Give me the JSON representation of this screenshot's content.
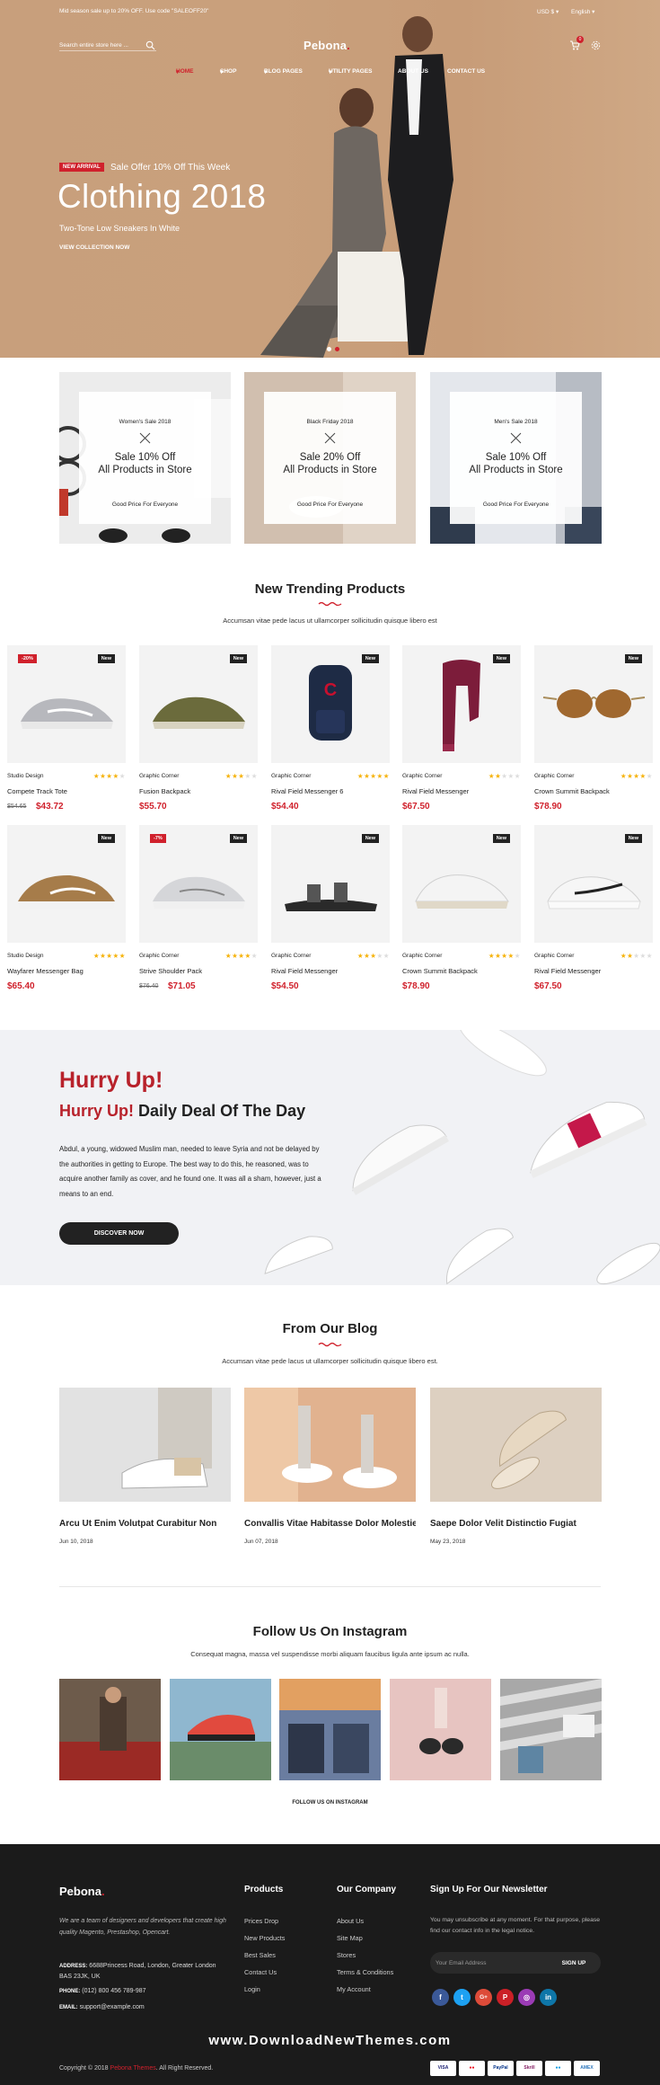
{
  "topbar": {
    "promo": "Mid season sale up to 20% OFF. Use code \"SALEOFF20\"",
    "currency": "USD $",
    "language": "English"
  },
  "header": {
    "search_placeholder": "Search entire store here ...",
    "logo": "Pebona",
    "logo_dot": ".",
    "cart_count": "0"
  },
  "nav": [
    {
      "label": "HOME",
      "arrow": true
    },
    {
      "label": "SHOP",
      "arrow": true
    },
    {
      "label": "BLOG PAGES",
      "arrow": true
    },
    {
      "label": "UTILITY PAGES",
      "arrow": true
    },
    {
      "label": "ABOUT US",
      "arrow": false
    },
    {
      "label": "CONTACT US",
      "arrow": false
    }
  ],
  "hero": {
    "badge": "NEW ARRIVAL",
    "offer": "Sale Offer 10% Off This Week",
    "title": "Clothing 2018",
    "subtitle": "Two-Tone Low Sneakers In White",
    "cta": "VIEW COLLECTION NOW"
  },
  "banners": [
    {
      "small": "Women's Sale 2018",
      "big1": "Sale 10% Off",
      "big2": "All Products in Store",
      "foot": "Good Price For Everyone"
    },
    {
      "small": "Black Friday 2018",
      "big1": "Sale 20% Off",
      "big2": "All Products in Store",
      "foot": "Good Price For Everyone"
    },
    {
      "small": "Men's Sale 2018",
      "big1": "Sale 10% Off",
      "big2": "All Products in Store",
      "foot": "Good Price For Everyone"
    }
  ],
  "trending": {
    "title": "New Trending Products",
    "subtitle": "Accumsan vitae pede lacus ut ullamcorper sollicitudin quisque libero est"
  },
  "products": [
    {
      "badge": "-20%",
      "tag": "New",
      "category": "Studio Design",
      "rating": 4,
      "name": "Compete Track Tote",
      "old_price": "$54.65",
      "price": "$43.72",
      "image": "sneaker-grey"
    },
    {
      "badge": "",
      "tag": "New",
      "category": "Graphic Corner",
      "rating": 3,
      "name": "Fusion Backpack",
      "old_price": "",
      "price": "$55.70",
      "image": "sneaker-olive"
    },
    {
      "badge": "",
      "tag": "New",
      "category": "Graphic Corner",
      "rating": 5,
      "name": "Rival Field Messenger 6",
      "old_price": "",
      "price": "$54.40",
      "image": "backpack"
    },
    {
      "badge": "",
      "tag": "New",
      "category": "Graphic Corner",
      "rating": 2,
      "name": "Rival Field Messenger",
      "old_price": "",
      "price": "$67.50",
      "image": "scarf"
    },
    {
      "badge": "",
      "tag": "New",
      "category": "Graphic Corner",
      "rating": 4,
      "name": "Crown Summit Backpack",
      "old_price": "",
      "price": "$78.90",
      "image": "sunglasses"
    },
    {
      "badge": "",
      "tag": "New",
      "category": "Studio Design",
      "rating": 5,
      "name": "Wayfarer Messenger Bag",
      "old_price": "",
      "price": "$65.40",
      "image": "sneaker-tan"
    },
    {
      "badge": "-7%",
      "tag": "New",
      "category": "Graphic Corner",
      "rating": 4,
      "name": "Strive Shoulder Pack",
      "old_price": "$76.40",
      "price": "$71.05",
      "image": "sneaker-lightgrey"
    },
    {
      "badge": "",
      "tag": "New",
      "category": "Graphic Corner",
      "rating": 3,
      "name": "Rival Field Messenger",
      "old_price": "",
      "price": "$54.50",
      "image": "sandal"
    },
    {
      "badge": "",
      "tag": "New",
      "category": "Graphic Corner",
      "rating": 4,
      "name": "Crown Summit Backpack",
      "old_price": "",
      "price": "$78.90",
      "image": "sneaker-white"
    },
    {
      "badge": "",
      "tag": "New",
      "category": "Graphic Corner",
      "rating": 2,
      "name": "Rival Field Messenger",
      "old_price": "",
      "price": "$67.50",
      "image": "sneaker-white-swoosh"
    }
  ],
  "deal": {
    "headline": "Hurry Up!",
    "sub_red": "Hurry Up!",
    "sub_dark": "Daily Deal Of The Day",
    "body": "Abdul, a young, widowed Muslim man, needed to leave Syria and not be delayed by the authorities in getting to Europe. The best way to do this, he reasoned, was to acquire another family as cover, and he found one. It was all a sham, however, just a means to an end.",
    "button": "DISCOVER NOW"
  },
  "blog": {
    "title": "From Our Blog",
    "subtitle": "Accumsan vitae pede lacus ut ullamcorper sollicitudin quisque libero est.",
    "posts": [
      {
        "title": "Arcu Ut Enim Volutpat Curabitur Non",
        "date": "Jun 10, 2018"
      },
      {
        "title": "Convallis Vitae Habitasse Dolor Molestie",
        "date": "Jun 07, 2018"
      },
      {
        "title": "Saepe Dolor Velit Distinctio Fugiat",
        "date": "May 23, 2018"
      }
    ]
  },
  "instagram": {
    "title": "Follow Us On Instagram",
    "subtitle": "Consequat magna, massa vel suspendisse morbi aliquam faucibus ligula ante ipsum ac nulla.",
    "link": "FOLLOW US ON INSTAGRAM"
  },
  "footer": {
    "logo": "Pebona",
    "logo_dot": ".",
    "about": "We are a team of designers and developers that create high quality Magento, Prestashop, Opencart.",
    "address_label": "ADDRESS:",
    "address": "6688Princess Road, London, Greater London BAS 23JK, UK",
    "phone_label": "PHONE:",
    "phone": "(012) 800 456 789-987",
    "email_label": "EMAIL:",
    "email": "support@example.com",
    "products_title": "Products",
    "products_links": [
      "Prices Drop",
      "New Products",
      "Best Sales",
      "Contact Us",
      "Login"
    ],
    "company_title": "Our Company",
    "company_links": [
      "About Us",
      "Site Map",
      "Stores",
      "Terms & Conditions",
      "My Account"
    ],
    "newsletter_title": "Sign Up For Our Newsletter",
    "newsletter_text": "You may unsubscribe at any moment. For that purpose, please find our contact info in the legal notice.",
    "newsletter_placeholder": "Your Email Address",
    "newsletter_button": "SIGN UP",
    "social": [
      {
        "icon": "f",
        "color": "#3b5998"
      },
      {
        "icon": "t",
        "color": "#1da1f2"
      },
      {
        "icon": "G+",
        "color": "#dd4b39"
      },
      {
        "icon": "P",
        "color": "#cb2027"
      },
      {
        "icon": "◎",
        "color": "#9b3bb5"
      },
      {
        "icon": "in",
        "color": "#0e76a8"
      }
    ],
    "watermark": "www.DownloadNewThemes.com",
    "copyright_pre": "Copyright © 2018",
    "copyright_brand": "Pebona Themes",
    "copyright_post": ". All Right Reserved.",
    "payments": [
      {
        "label": "VISA",
        "color": "#1a1f71"
      },
      {
        "label": "●●",
        "color": "#eb001b"
      },
      {
        "label": "PayPal",
        "color": "#003087"
      },
      {
        "label": "Skrill",
        "color": "#862165"
      },
      {
        "label": "●●",
        "color": "#0099df"
      },
      {
        "label": "AMEX",
        "color": "#2e77bc"
      }
    ]
  },
  "colors": {
    "accent": "#d0212c",
    "dark": "#1b1b1b",
    "hero_bg": "#c89f7c",
    "deal_bg": "#f1f2f5",
    "star": "#f6b30c"
  }
}
